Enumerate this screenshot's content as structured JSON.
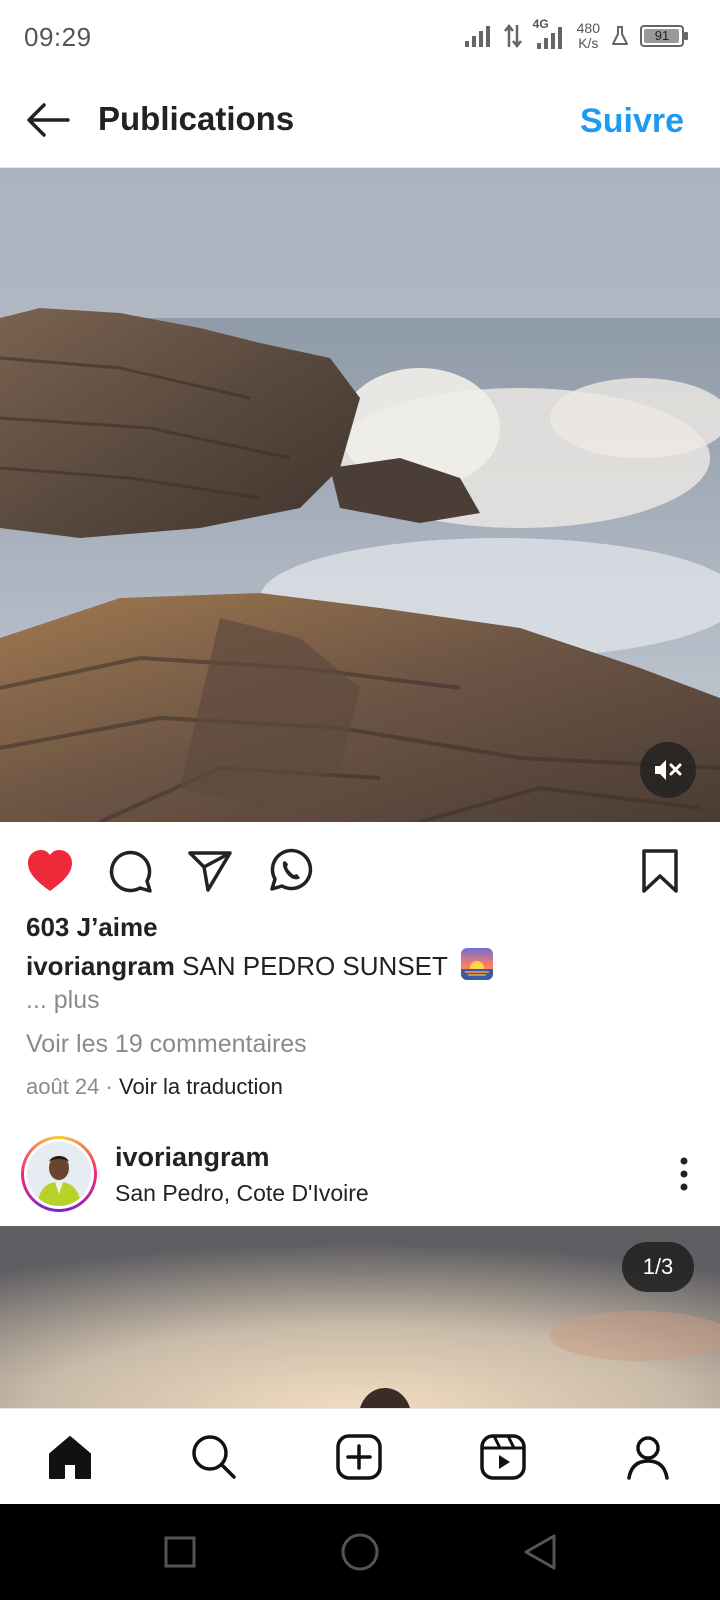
{
  "status_bar": {
    "time": "09:29",
    "network": "4G",
    "speed_value": "480",
    "speed_unit": "K/s",
    "battery": "91"
  },
  "header": {
    "title": "Publications",
    "follow_label": "Suivre"
  },
  "post": {
    "likes": "603 J’aime",
    "username": "ivoriangram",
    "caption": "SAN PEDRO SUNSET",
    "more_label": "... plus",
    "comments_link": "Voir les 19 commentaires",
    "date": "août 24",
    "separator": "·",
    "translate_label": "Voir la traduction"
  },
  "next_post": {
    "username": "ivoriangram",
    "location": "San Pedro, Cote D'Ivoire",
    "counter": "1/3"
  },
  "icons": {
    "back": "arrow-left-icon",
    "mute": "volume-muted-icon",
    "like": "heart-icon",
    "comment": "comment-icon",
    "share": "send-icon",
    "whatsapp": "whatsapp-icon",
    "save": "bookmark-icon",
    "more": "more-vertical-icon",
    "nav": [
      "home-icon",
      "search-icon",
      "add-post-icon",
      "reels-icon",
      "profile-icon"
    ],
    "system": [
      "recents-icon",
      "home-circle-icon",
      "back-triangle-icon"
    ]
  },
  "colors": {
    "accent": "#1d9bf0",
    "like_red": "#ee2a3a",
    "muted_text": "#8a8a8a"
  }
}
